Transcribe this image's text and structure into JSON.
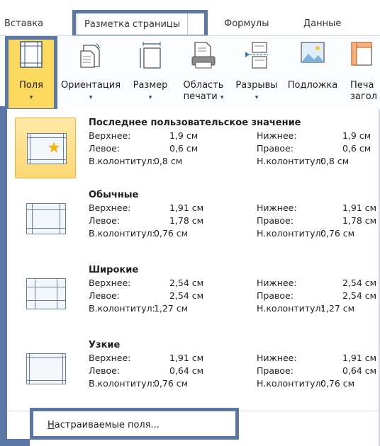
{
  "tabs": [
    {
      "label": "Вставка",
      "active": false
    },
    {
      "label": "Разметка страницы",
      "active": true
    },
    {
      "label": "Формулы",
      "active": false
    },
    {
      "label": "Данные",
      "active": false
    }
  ],
  "ribbon": {
    "buttons": [
      {
        "label": "Поля",
        "icon": "margins-icon",
        "has_dropdown": true,
        "active": true
      },
      {
        "label": "Ориентация",
        "icon": "orientation-icon",
        "has_dropdown": true
      },
      {
        "label": "Размер",
        "icon": "size-icon",
        "has_dropdown": true
      },
      {
        "label_line1": "Область",
        "label_line2": "печати",
        "icon": "print-area-icon",
        "has_dropdown": true
      },
      {
        "label": "Разрывы",
        "icon": "breaks-icon",
        "has_dropdown": true
      },
      {
        "label": "Подложка",
        "icon": "background-icon",
        "has_dropdown": false
      },
      {
        "label_line1": "Печа",
        "label_line2": "загол",
        "icon": "print-titles-icon",
        "has_dropdown": false
      }
    ],
    "dropdown_arrow": "▾"
  },
  "margins_menu": {
    "options": [
      {
        "title": "Последнее пользовательское значение",
        "top_label": "Верхнее:",
        "top": "1,9 см",
        "bottom_label": "Нижнее:",
        "bottom": "1,9 см",
        "left_label": "Левое:",
        "left": "0,6 см",
        "right_label": "Правое:",
        "right": "0,6 см",
        "header_label": "В.колонтитул:",
        "header": "0,8 см",
        "footer_label": "Н.колонтитул:",
        "footer": "0,8 см",
        "icon": "star-icon",
        "selected": true
      },
      {
        "title": "Обычные",
        "top_label": "Верхнее:",
        "top": "1,91 см",
        "bottom_label": "Нижнее:",
        "bottom": "1,91 см",
        "left_label": "Левое:",
        "left": "1,78 см",
        "right_label": "Правое:",
        "right": "1,78 см",
        "header_label": "В.колонтитул:",
        "header": "0,76 см",
        "footer_label": "Н.колонтитул:",
        "footer": "0,76 см"
      },
      {
        "title": "Широкие",
        "top_label": "Верхнее:",
        "top": "2,54 см",
        "bottom_label": "Нижнее:",
        "bottom": "2,54 см",
        "left_label": "Левое:",
        "left": "2,54 см",
        "right_label": "Правое:",
        "right": "2,54 см",
        "header_label": "В.колонтитул:",
        "header": "1,27 см",
        "footer_label": "Н.колонтитул:",
        "footer": "1,27 см"
      },
      {
        "title": "Узкие",
        "top_label": "Верхнее:",
        "top": "1,91 см",
        "bottom_label": "Нижнее:",
        "bottom": "1,91 см",
        "left_label": "Левое:",
        "left": "0,64 см",
        "right_label": "Правое:",
        "right": "0,64 см",
        "header_label": "В.колонтитул:",
        "header": "0,76 см",
        "footer_label": "Н.колонтитул:",
        "footer": "0,76 см"
      }
    ],
    "custom_margins_accel": "Н",
    "custom_margins_rest": "астраиваемые поля..."
  },
  "colors": {
    "highlight_border": "#5a77a6",
    "active_button": "#fbd95f",
    "selected_thumb": "#fdd873"
  }
}
